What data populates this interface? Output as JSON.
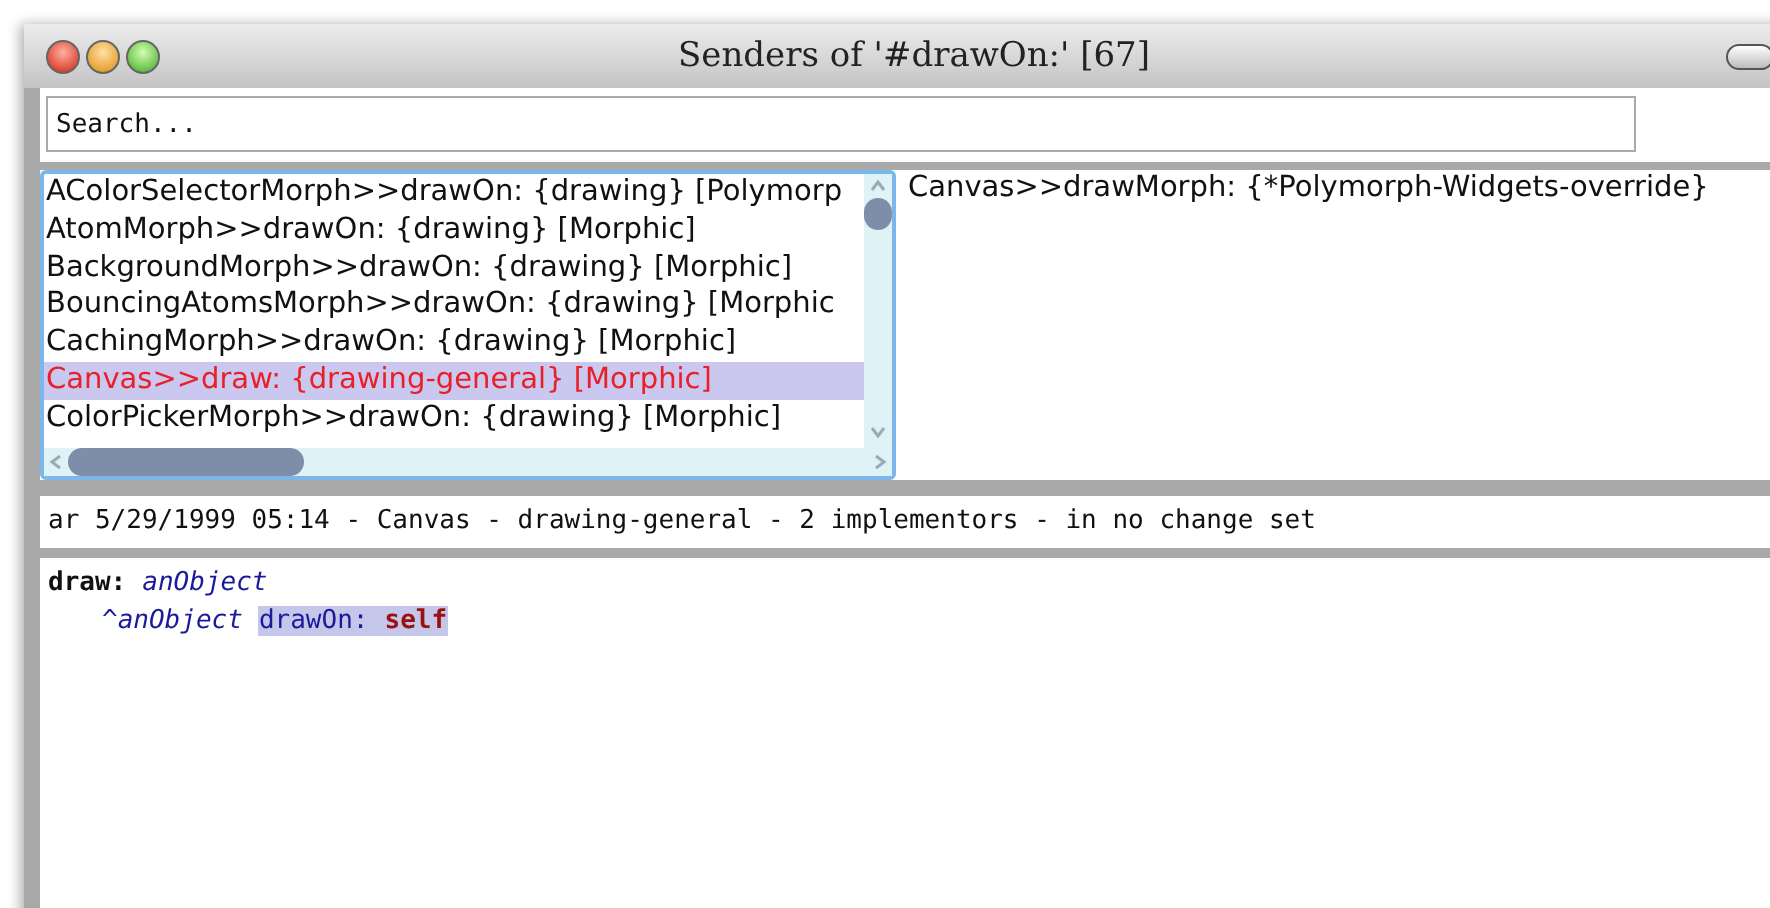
{
  "window": {
    "title": "Senders of '#drawOn:' [67]"
  },
  "search": {
    "placeholder": "Search..."
  },
  "senders": [
    {
      "label": "AColorSelectorMorph>>drawOn: {drawing} [Polymorp",
      "selected": false
    },
    {
      "label": "AtomMorph>>drawOn: {drawing} [Morphic]",
      "selected": false
    },
    {
      "label": "BackgroundMorph>>drawOn: {drawing} [Morphic]",
      "selected": false
    },
    {
      "label": "BouncingAtomsMorph>>drawOn: {drawing} [Morphic",
      "selected": false
    },
    {
      "label": "CachingMorph>>drawOn: {drawing} [Morphic]",
      "selected": false
    },
    {
      "label": "Canvas>>draw: {drawing-general} [Morphic]",
      "selected": true
    },
    {
      "label": "ColorPickerMorph>>drawOn: {drawing} [Morphic]",
      "selected": false
    }
  ],
  "implementors": [
    {
      "label": "Canvas>>drawMorph: {*Polymorph-Widgets-override}",
      "selected": false
    }
  ],
  "status_bar": "ar 5/29/1999 05:14 - Canvas - drawing-general - 2 implementors - in no change set",
  "code": {
    "lines": [
      [
        {
          "text": "draw:",
          "kind": "selector",
          "selected": false
        },
        {
          "text": "anObject",
          "kind": "argument",
          "selected": false
        }
      ],
      [
        {
          "text": "^anObject",
          "kind": "return",
          "selected": false
        },
        {
          "text": "drawOn:",
          "kind": "message",
          "selected": true
        },
        {
          "text": "self",
          "kind": "pseudo",
          "selected": true
        }
      ]
    ]
  }
}
